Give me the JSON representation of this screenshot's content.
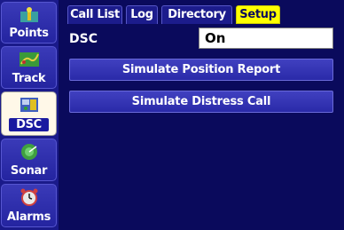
{
  "sidebar": {
    "items": [
      {
        "label": "Points",
        "icon": "points-icon"
      },
      {
        "label": "Track",
        "icon": "track-icon"
      },
      {
        "label": "DSC",
        "icon": "dsc-icon",
        "active": true
      },
      {
        "label": "Sonar",
        "icon": "sonar-icon"
      },
      {
        "label": "Alarms",
        "icon": "alarm-clock-icon"
      }
    ]
  },
  "tabs": [
    {
      "label": "Call List"
    },
    {
      "label": "Log"
    },
    {
      "label": "Directory"
    },
    {
      "label": "Setup",
      "active": true
    }
  ],
  "settings": {
    "dsc_label": "DSC",
    "dsc_value": "On"
  },
  "actions": {
    "simulate_position": "Simulate Position Report",
    "simulate_distress": "Simulate Distress Call"
  },
  "colors": {
    "background": "#0a0a5c",
    "active_tab": "#ffff00",
    "button": "#3434b4"
  }
}
